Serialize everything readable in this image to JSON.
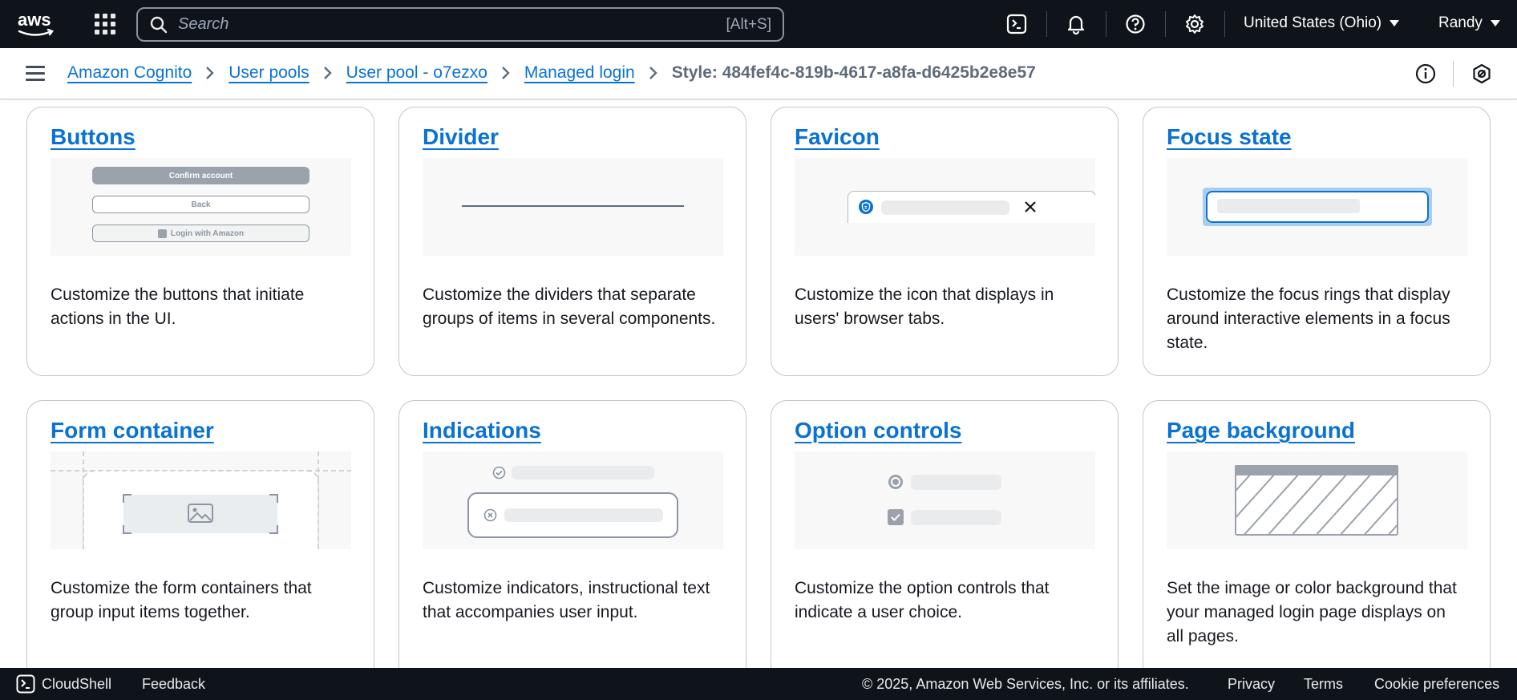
{
  "topnav": {
    "logo_text": "aws",
    "search_placeholder": "Search",
    "search_shortcut": "[Alt+S]",
    "region": "United States (Ohio)",
    "user": "Randy"
  },
  "breadcrumb": {
    "items": [
      "Amazon Cognito",
      "User pools",
      "User pool - o7ezxo",
      "Managed login"
    ],
    "current": "Style: 484fef4c-819b-4617-a8fa-d6425b2e8e57"
  },
  "cards": [
    {
      "title": "Buttons",
      "desc": "Customize the buttons that initiate actions in the UI.",
      "preview": {
        "primary": "Confirm account",
        "secondary": "Back",
        "social": "Login with Amazon"
      }
    },
    {
      "title": "Divider",
      "desc": "Customize the dividers that separate groups of items in several components."
    },
    {
      "title": "Favicon",
      "desc": "Customize the icon that displays in users' browser tabs."
    },
    {
      "title": "Focus state",
      "desc": "Customize the focus rings that display around interactive elements in a focus state."
    },
    {
      "title": "Form container",
      "desc": "Customize the form containers that group input items together."
    },
    {
      "title": "Indications",
      "desc": "Customize indicators, instructional text that accompanies user input."
    },
    {
      "title": "Option controls",
      "desc": "Customize the option controls that indicate a user choice."
    },
    {
      "title": "Page background",
      "desc": "Set the image or color background that your managed login page displays on all pages."
    }
  ],
  "footer": {
    "cloudshell": "CloudShell",
    "feedback": "Feedback",
    "copyright": "© 2025, Amazon Web Services, Inc. or its affiliates.",
    "privacy": "Privacy",
    "terms": "Terms",
    "cookies": "Cookie preferences"
  },
  "colors": {
    "nav_bg": "#0f141a",
    "link": "#0972d3",
    "text": "#16191f",
    "border": "#c6c6cd"
  }
}
